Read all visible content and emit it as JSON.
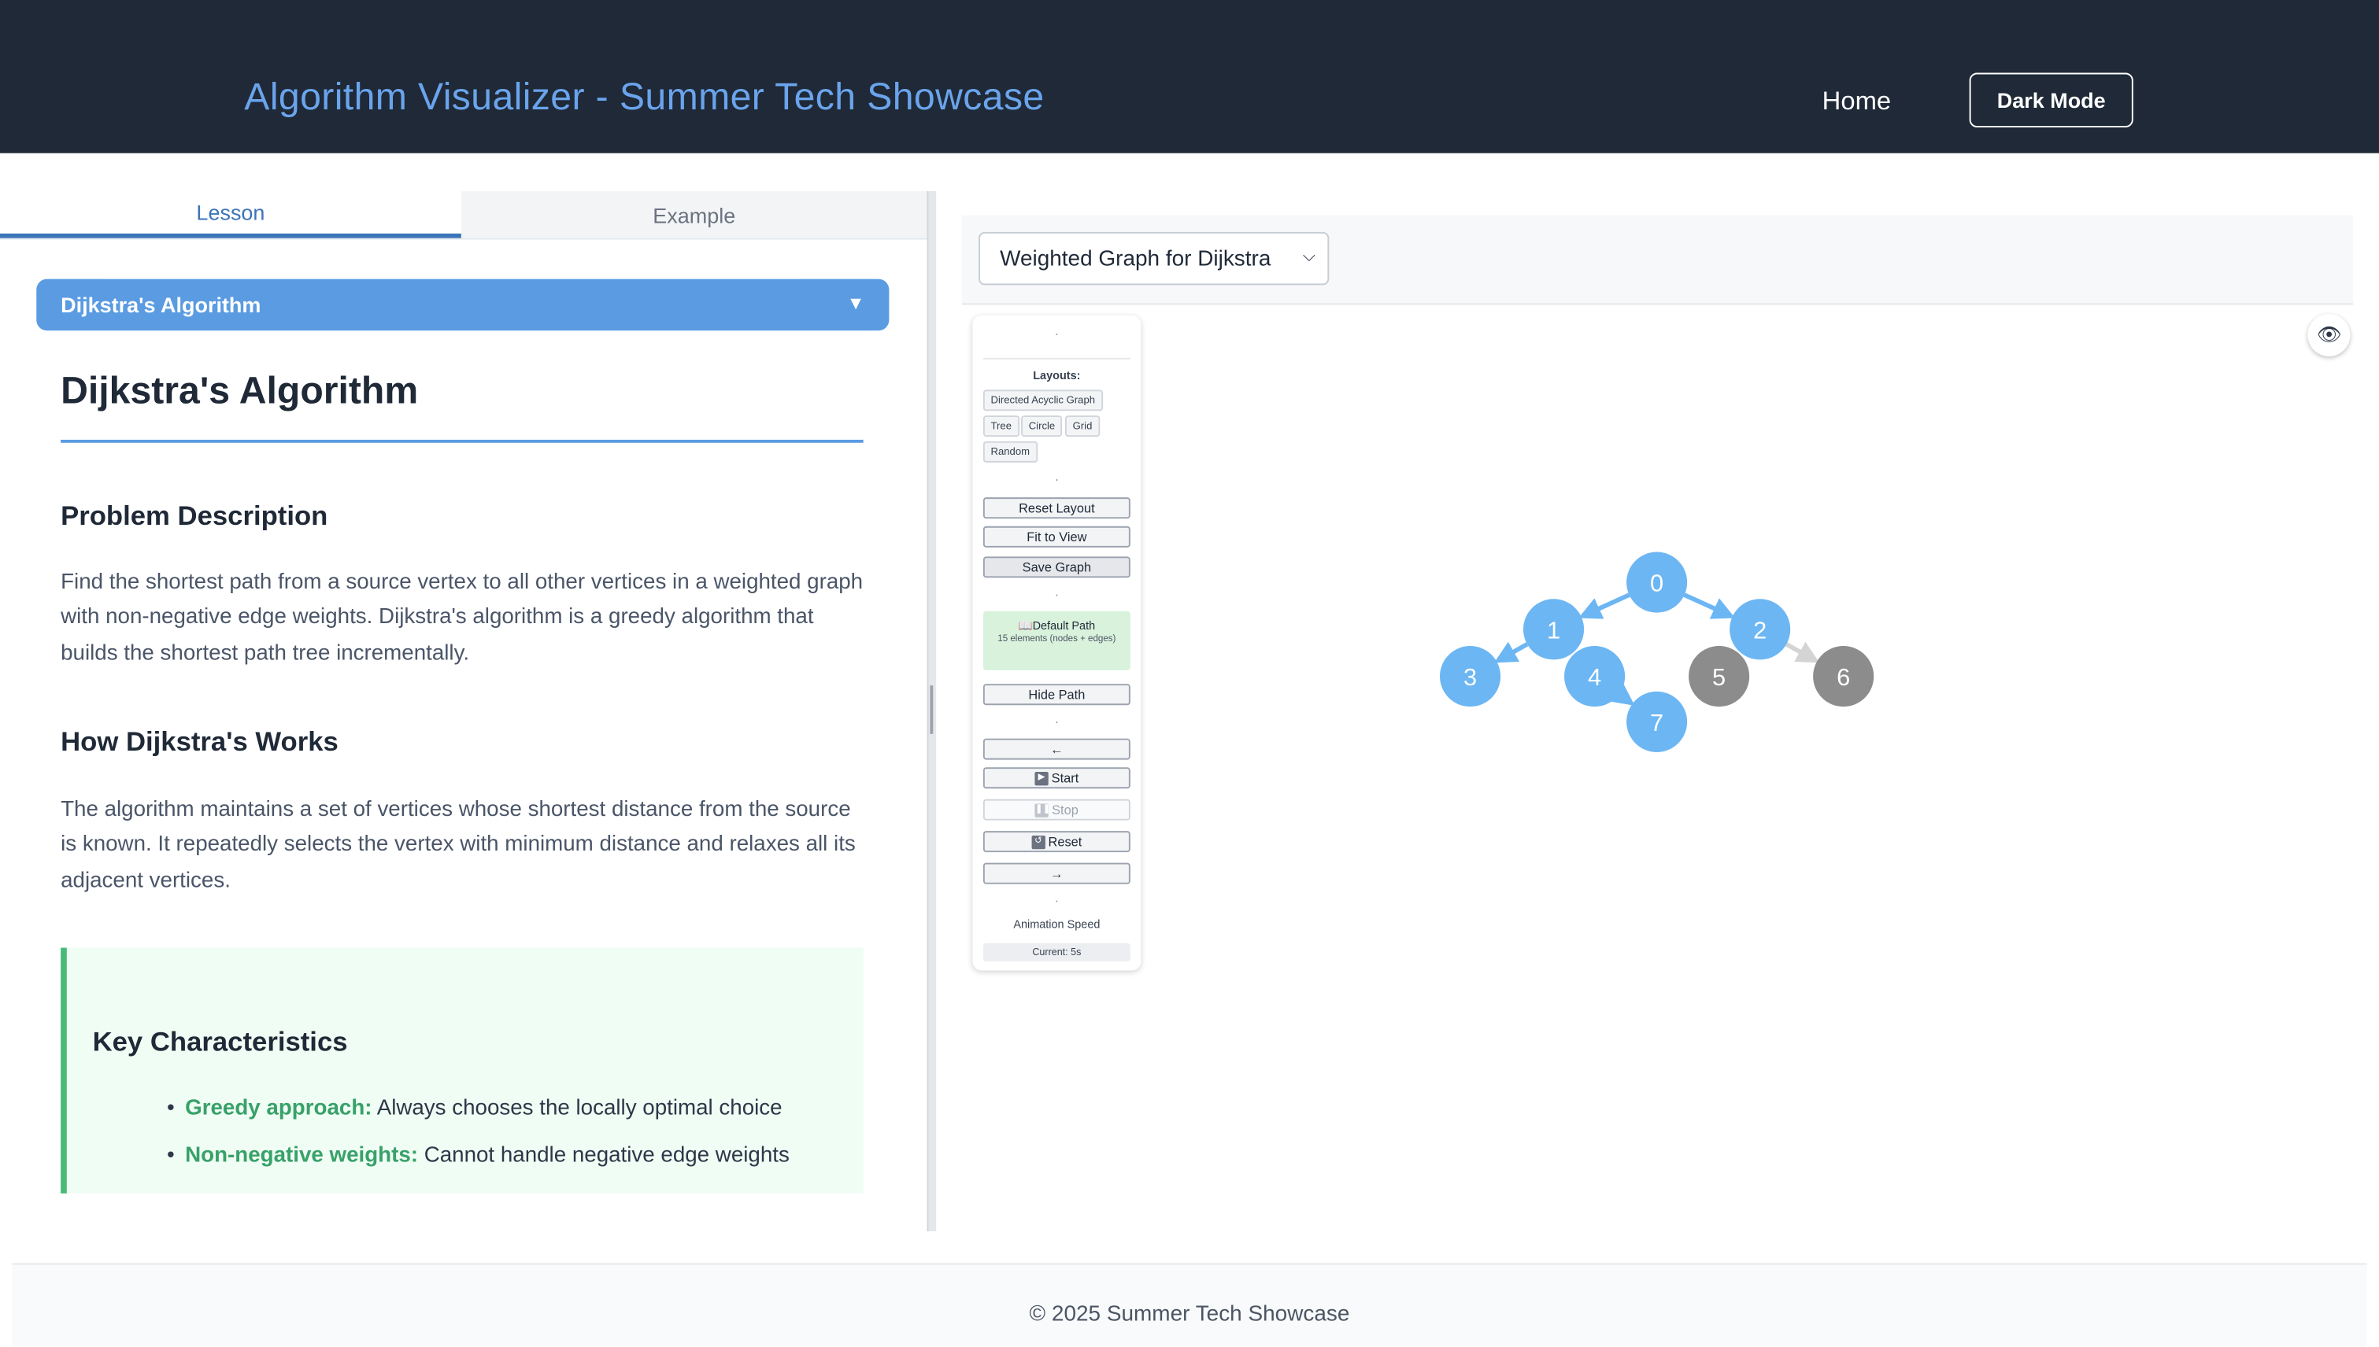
{
  "header": {
    "title": "Algorithm Visualizer - Summer Tech Showcase",
    "nav_home": "Home",
    "dark_mode_label": "Dark Mode"
  },
  "left_panel": {
    "tabs": [
      {
        "label": "Lesson",
        "active": true
      },
      {
        "label": "Example",
        "active": false
      }
    ],
    "accordion_title": "Dijkstra's Algorithm",
    "accordion_arrow": "▼",
    "heading": "Dijkstra's Algorithm",
    "sections": [
      {
        "title": "Problem Description",
        "body": "Find the shortest path from a source vertex to all other vertices in a weighted graph with non-negative edge weights. Dijkstra's algorithm is a greedy algorithm that builds the shortest path tree incrementally."
      },
      {
        "title": "How Dijkstra's Works",
        "body": "The algorithm maintains a set of vertices whose shortest distance from the source is known. It repeatedly selects the vertex with minimum distance and relaxes all its adjacent vertices."
      }
    ],
    "key_characteristics": {
      "title": "Key Characteristics",
      "items": [
        {
          "term": "Greedy approach:",
          "text": " Always chooses the locally optimal choice"
        },
        {
          "term": "Non-negative weights:",
          "text": " Cannot handle negative edge weights"
        }
      ]
    }
  },
  "right_panel": {
    "graph_select": {
      "selected": "Weighted Graph for Dijkstra",
      "chevron": "⌄"
    },
    "controls": {
      "dot": "·",
      "layouts_label": "Layouts:",
      "layouts": [
        "Directed Acyclic Graph",
        "Tree",
        "Circle",
        "Grid",
        "Random"
      ],
      "reset_layout": "Reset Layout",
      "fit_to_view": "Fit to View",
      "save_graph": "Save Graph",
      "path_title": "📖Default Path",
      "path_subtitle": "15 elements (nodes + edges)",
      "hide_path": "Hide Path",
      "prev": "←",
      "start": "Start",
      "stop": "Stop",
      "reset": "Reset",
      "next": "→",
      "speed_label": "Animation Speed",
      "current_speed": "Current: 5s"
    },
    "eye_icon": "👁",
    "graph": {
      "nodes": [
        {
          "id": "0",
          "state": "visited"
        },
        {
          "id": "1",
          "state": "visited"
        },
        {
          "id": "2",
          "state": "visited"
        },
        {
          "id": "3",
          "state": "visited"
        },
        {
          "id": "4",
          "state": "visited"
        },
        {
          "id": "5",
          "state": "unvisited"
        },
        {
          "id": "6",
          "state": "unvisited"
        },
        {
          "id": "7",
          "state": "visited"
        }
      ],
      "edges": [
        {
          "from": "0",
          "to": "1",
          "state": "visited"
        },
        {
          "from": "0",
          "to": "2",
          "state": "visited"
        },
        {
          "from": "1",
          "to": "3",
          "state": "visited"
        },
        {
          "from": "4",
          "to": "7",
          "state": "visited"
        },
        {
          "from": "2",
          "to": "6",
          "state": "unvisited"
        }
      ],
      "colors": {
        "visited_node": "#6cb6f3",
        "unvisited_node": "#8c8c8c",
        "visited_edge": "#6cb6f3",
        "unvisited_edge": "#d4d4d4"
      }
    }
  },
  "footer": {
    "text": "© 2025 Summer Tech Showcase"
  }
}
